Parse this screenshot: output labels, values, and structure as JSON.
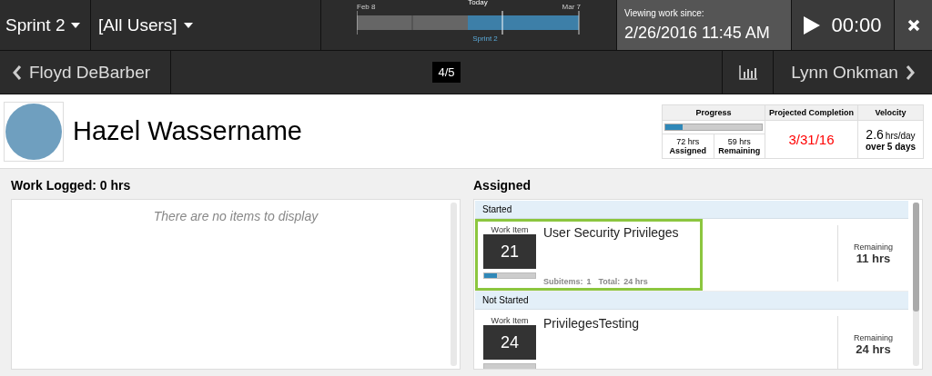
{
  "top_bar": {
    "sprint_menu": "Sprint 2",
    "user_menu": "[All Users]",
    "timeline": {
      "start": "Feb 8",
      "today": "Today",
      "end": "Mar 7",
      "sprint": "Sprint 2"
    },
    "viewing_label": "Viewing work since:",
    "viewing_date": "2/26/2016 11:45 AM",
    "timer": "00:00"
  },
  "nav_bar": {
    "previous": "Floyd DeBarber",
    "counter": "4/5",
    "next": "Lynn Onkman"
  },
  "profile": {
    "name": "Hazel Wassername"
  },
  "stats": {
    "progress_header": "Progress",
    "progress": {
      "level": 0.18
    },
    "assigned_value": "72 hrs",
    "assigned_label": "Assigned",
    "remaining_value": "59 hrs",
    "remaining_label": "Remaining",
    "completion_header": "Projected Completion",
    "completion_date": "3/31/16",
    "velocity_header": "Velocity",
    "velocity_value": "2.6",
    "velocity_unit": "hrs/day",
    "velocity_period": "over 5 days"
  },
  "work_logged": {
    "title": "Work Logged: 0 hrs",
    "empty_message": "There are no items to display"
  },
  "assigned": {
    "title": "Assigned",
    "groups": [
      {
        "label": "Started",
        "items": [
          {
            "type_label": "Work Item",
            "number": "21",
            "title": "User Security Privileges",
            "level": 0.25,
            "subitems_label": "Subitems:",
            "subitems": "1",
            "total_label": "Total:",
            "total": "24 hrs",
            "remaining_label": "Remaining",
            "remaining": "11 hrs",
            "selected": true
          }
        ]
      },
      {
        "label": "Not Started",
        "items": [
          {
            "type_label": "Work Item",
            "number": "24",
            "title": "PrivilegesTesting",
            "remaining_label": "Remaining",
            "remaining": "24 hrs",
            "selected": false
          }
        ]
      }
    ]
  }
}
